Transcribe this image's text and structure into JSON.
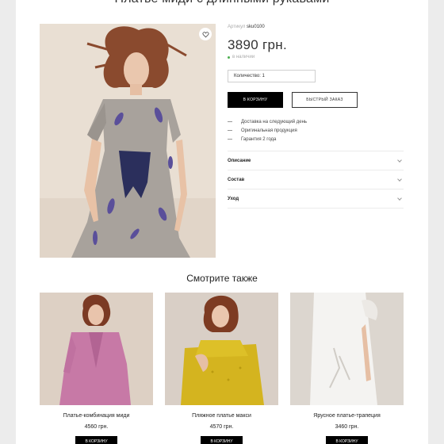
{
  "product": {
    "title": "Платье миди с длинными рукавами",
    "sku_label": "Артикул",
    "sku_value": "sku0100",
    "price": "3890 грн.",
    "stock": "в наличии",
    "quantity": "Количество: 1",
    "add_to_cart": "В корзину",
    "quick_order": "Быстрый заказ",
    "features": [
      "Доставка на следующий день",
      "Оригинальная продукция",
      "Гарантия 2 года"
    ],
    "accordion": [
      "Описание",
      "Состав",
      "Уход"
    ]
  },
  "related": {
    "heading": "Смотрите также",
    "items": [
      {
        "name": "Платье-комбинация миди",
        "price": "4560 грн.",
        "button": "В корзину"
      },
      {
        "name": "Пляжное платье макси",
        "price": "4570 грн.",
        "button": "В корзину"
      },
      {
        "name": "Ярусное платье-трапеция",
        "price": "3460 грн.",
        "button": "В корзину"
      }
    ]
  },
  "icons": {
    "favorite": "heart-icon",
    "expand": "chevron-down-icon"
  },
  "colors": {
    "accent": "#000000",
    "in_stock": "#4caf50",
    "background": "#ffffff"
  }
}
